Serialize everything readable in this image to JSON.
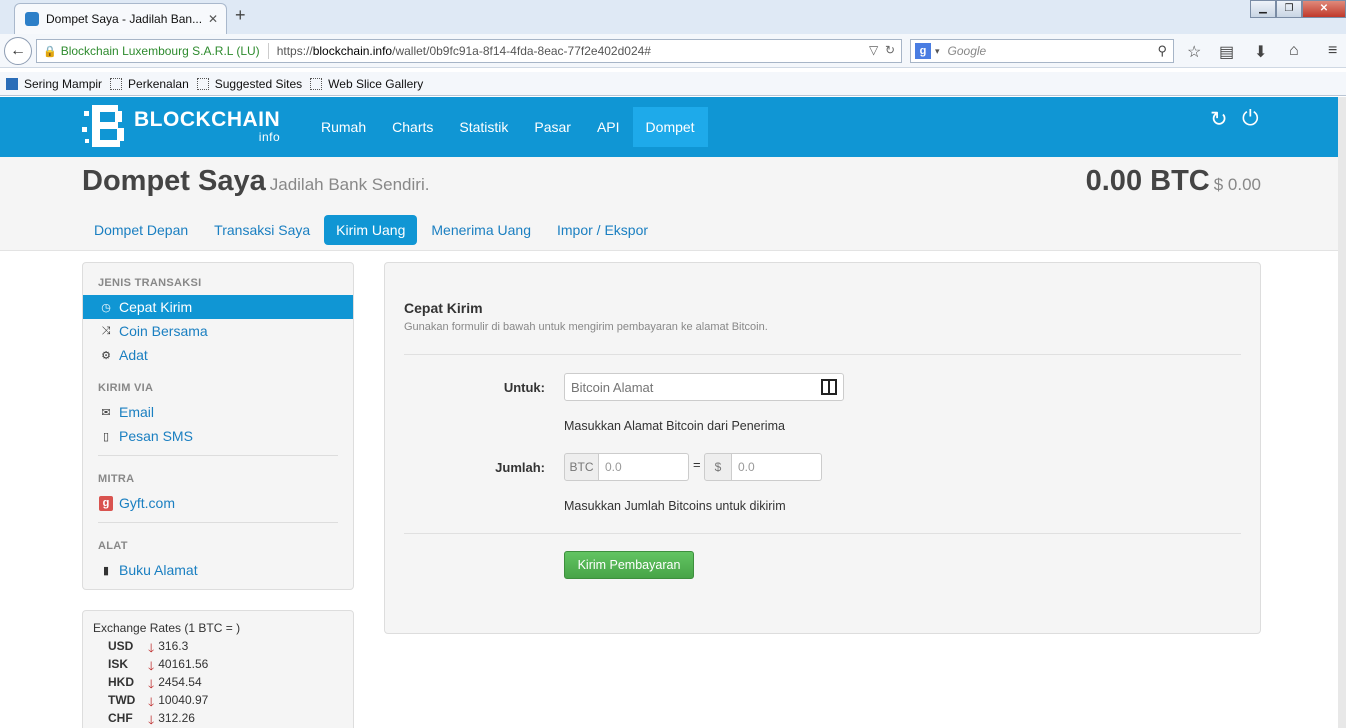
{
  "browser": {
    "tab_title": "Dompet Saya - Jadilah Ban...",
    "identity": "Blockchain Luxembourg S.A.R.L (LU)",
    "url_prefix": "https://",
    "url_host": "blockchain.info",
    "url_path": "/wallet/0b9fc91a-8f14-4fda-8eac-77f2e402d024#",
    "search_placeholder": "Google",
    "bookmarks": [
      "Sering Mampir",
      "Perkenalan",
      "Suggested Sites",
      "Web Slice Gallery"
    ]
  },
  "header": {
    "logo_text": "BLOCKCHAIN",
    "logo_sub": "info",
    "nav": [
      "Rumah",
      "Charts",
      "Statistik",
      "Pasar",
      "API",
      "Dompet"
    ],
    "active_nav": "Dompet"
  },
  "subheader": {
    "title": "Dompet Saya",
    "subtitle": "Jadilah Bank Sendiri.",
    "balance_btc": "0.00 BTC",
    "balance_usd": "$ 0.00",
    "tabs": [
      "Dompet Depan",
      "Transaksi Saya",
      "Kirim Uang",
      "Menerima Uang",
      "Impor / Ekspor"
    ],
    "active_tab": "Kirim Uang"
  },
  "sidebar": {
    "sections": [
      {
        "heading": "JENIS TRANSAKSI",
        "items": [
          "Cepat Kirim",
          "Coin Bersama",
          "Adat"
        ]
      },
      {
        "heading": "KIRIM VIA",
        "items": [
          "Email",
          "Pesan SMS"
        ]
      },
      {
        "heading": "MITRA",
        "items": [
          "Gyft.com"
        ]
      },
      {
        "heading": "ALAT",
        "items": [
          "Buku Alamat"
        ]
      }
    ],
    "active_item": "Cepat Kirim"
  },
  "rates": {
    "title": "Exchange Rates (1 BTC = )",
    "rows": [
      {
        "currency": "USD",
        "value": "316.3"
      },
      {
        "currency": "ISK",
        "value": "40161.56"
      },
      {
        "currency": "HKD",
        "value": "2454.54"
      },
      {
        "currency": "TWD",
        "value": "10040.97"
      },
      {
        "currency": "CHF",
        "value": "312.26"
      }
    ]
  },
  "form": {
    "title": "Cepat Kirim",
    "subtitle": "Gunakan formulir di bawah untuk mengirim pembayaran ke alamat Bitcoin.",
    "to_label": "Untuk:",
    "to_placeholder": "Bitcoin Alamat",
    "to_help": "Masukkan Alamat Bitcoin dari Penerima",
    "amount_label": "Jumlah:",
    "btc_addon": "BTC",
    "btc_placeholder": "0.0",
    "eq": "=",
    "usd_addon": "$",
    "usd_placeholder": "0.0",
    "amount_help": "Masukkan Jumlah Bitcoins untuk dikirim",
    "submit_label": "Kirim Pembayaran"
  }
}
